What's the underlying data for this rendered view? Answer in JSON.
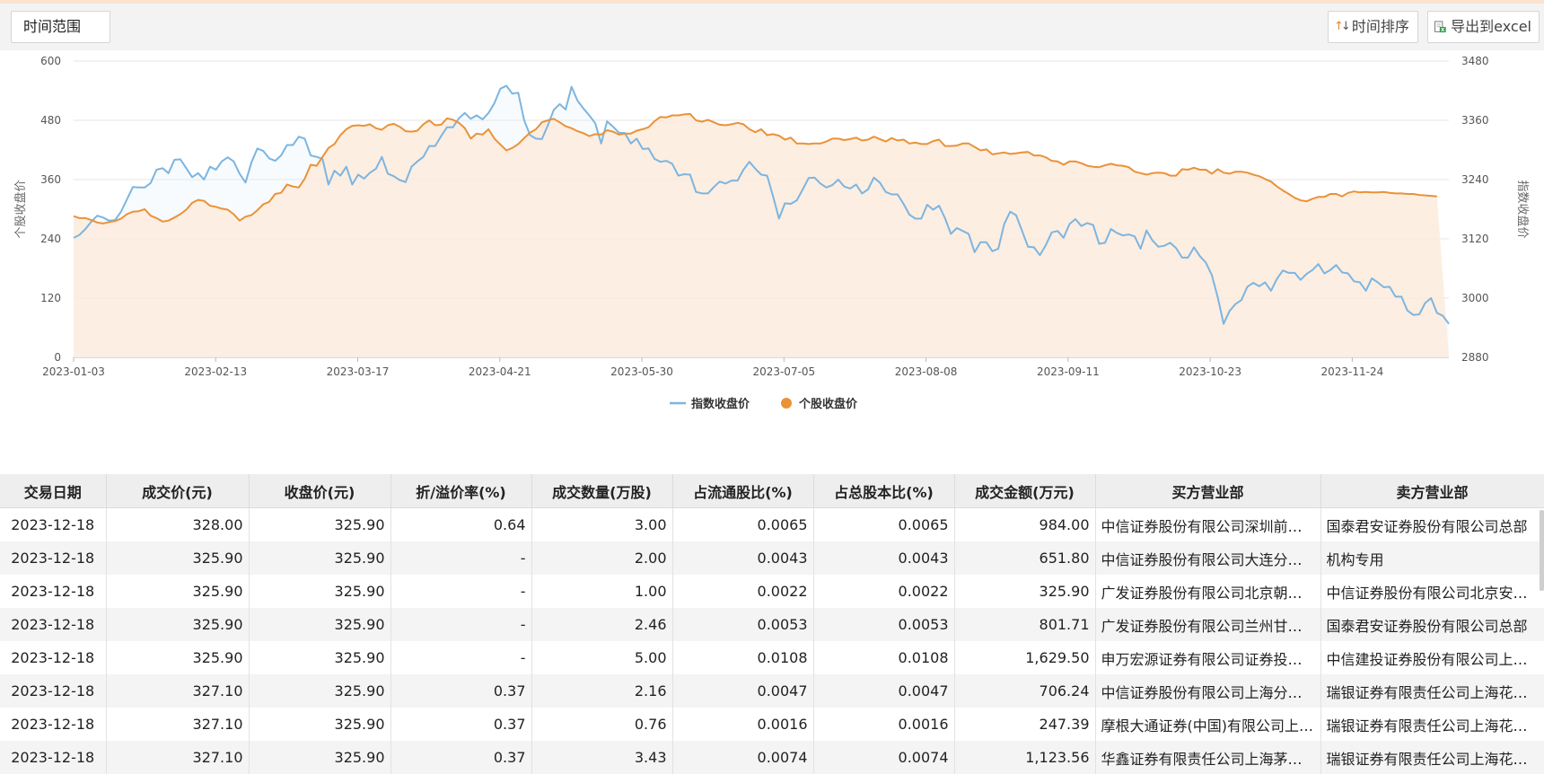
{
  "toolbar": {
    "range_label": "时间范围",
    "sort_label": "时间排序",
    "export_label": "导出到excel"
  },
  "chart_data": {
    "type": "line",
    "x_ticks": [
      "2023-01-03",
      "2023-02-13",
      "2023-03-17",
      "2023-04-21",
      "2023-05-30",
      "2023-07-05",
      "2023-08-08",
      "2023-09-11",
      "2023-10-23",
      "2023-11-24"
    ],
    "left_axis": {
      "label": "个股收盘价",
      "ticks": [
        0,
        120,
        240,
        360,
        480,
        600
      ],
      "range": [
        0,
        600
      ]
    },
    "right_axis": {
      "label": "指数收盘价",
      "ticks": [
        2880,
        3000,
        3120,
        3240,
        3360,
        3480
      ],
      "range": [
        2880,
        3480
      ]
    },
    "legend_position": "bottom-center",
    "grid": true,
    "series": [
      {
        "name": "指数收盘价",
        "axis": "right",
        "color": "#7cb5e0",
        "values": [
          3122,
          3128,
          3140,
          3155,
          3167,
          3163,
          3157,
          3158,
          3175,
          3200,
          3225,
          3224,
          3224,
          3233,
          3260,
          3263,
          3253,
          3280,
          3281,
          3263,
          3245,
          3253,
          3240,
          3266,
          3260,
          3277,
          3285,
          3277,
          3252,
          3234,
          3275,
          3303,
          3298,
          3283,
          3278,
          3289,
          3310,
          3310,
          3327,
          3323,
          3289,
          3286,
          3282,
          3230,
          3258,
          3248,
          3266,
          3230,
          3250,
          3242,
          3254,
          3262,
          3286,
          3252,
          3247,
          3239,
          3235,
          3266,
          3277,
          3286,
          3308,
          3308,
          3328,
          3346,
          3346,
          3364,
          3375,
          3363,
          3370,
          3362,
          3375,
          3395,
          3424,
          3430,
          3414,
          3416,
          3360,
          3330,
          3323,
          3322,
          3350,
          3381,
          3393,
          3382,
          3428,
          3400,
          3384,
          3370,
          3354,
          3313,
          3358,
          3347,
          3335,
          3334,
          3313,
          3323,
          3302,
          3303,
          3282,
          3276,
          3278,
          3272,
          3248,
          3251,
          3250,
          3215,
          3212,
          3212,
          3225,
          3236,
          3232,
          3238,
          3238,
          3260,
          3276,
          3262,
          3250,
          3248,
          3206,
          3161,
          3192,
          3191,
          3198,
          3220,
          3243,
          3244,
          3232,
          3224,
          3229,
          3240,
          3226,
          3222,
          3230,
          3212,
          3220,
          3244,
          3234,
          3215,
          3210,
          3210,
          3191,
          3169,
          3161,
          3161,
          3189,
          3179,
          3187,
          3162,
          3130,
          3142,
          3136,
          3130,
          3093,
          3113,
          3113,
          3095,
          3100,
          3150,
          3175,
          3168,
          3136,
          3104,
          3103,
          3087,
          3107,
          3133,
          3136,
          3122,
          3150,
          3160,
          3146,
          3152,
          3148,
          3110,
          3112,
          3140,
          3132,
          3127,
          3129,
          3125,
          3100,
          3137,
          3117,
          3104,
          3106,
          3112,
          3101,
          3082,
          3082,
          3103,
          3085,
          3072,
          3047,
          3002,
          2948,
          2974,
          2988,
          2996,
          3023,
          3031,
          3024,
          3032,
          3015,
          3039,
          3056,
          3051,
          3051,
          3037,
          3049,
          3057,
          3069,
          3050,
          3057,
          3067,
          3052,
          3050,
          3034,
          3032,
          3015,
          3040,
          3032,
          3022,
          3023,
          3003,
          3003,
          2975,
          2966,
          2967,
          2990,
          3000,
          2970,
          2964,
          2948
        ]
      },
      {
        "name": "个股收盘价",
        "axis": "left",
        "color": "#ea9238",
        "values": [
          286,
          282,
          282,
          278,
          273,
          271,
          274,
          276,
          281,
          290,
          295,
          296,
          300,
          287,
          282,
          275,
          277,
          283,
          290,
          299,
          313,
          319,
          317,
          307,
          305,
          301,
          299,
          290,
          277,
          285,
          288,
          298,
          310,
          315,
          331,
          333,
          350,
          346,
          344,
          362,
          390,
          388,
          406,
          424,
          432,
          450,
          462,
          469,
          470,
          469,
          472,
          464,
          461,
          470,
          473,
          467,
          458,
          457,
          459,
          472,
          480,
          470,
          471,
          484,
          481,
          475,
          464,
          443,
          453,
          451,
          462,
          443,
          431,
          419,
          424,
          432,
          444,
          455,
          462,
          476,
          480,
          483,
          476,
          468,
          464,
          458,
          454,
          448,
          452,
          451,
          460,
          457,
          451,
          453,
          453,
          459,
          462,
          466,
          478,
          487,
          486,
          490,
          490,
          492,
          493,
          480,
          477,
          481,
          476,
          471,
          470,
          472,
          475,
          472,
          462,
          456,
          462,
          450,
          452,
          449,
          441,
          445,
          433,
          433,
          432,
          433,
          433,
          437,
          443,
          443,
          440,
          442,
          445,
          439,
          441,
          447,
          442,
          437,
          444,
          439,
          441,
          433,
          435,
          432,
          432,
          438,
          441,
          428,
          428,
          429,
          433,
          433,
          426,
          419,
          421,
          411,
          413,
          415,
          412,
          413,
          415,
          416,
          409,
          409,
          405,
          398,
          397,
          390,
          397,
          397,
          393,
          388,
          386,
          385,
          389,
          392,
          389,
          388,
          385,
          376,
          373,
          370,
          373,
          374,
          373,
          368,
          368,
          381,
          380,
          384,
          380,
          380,
          372,
          381,
          374,
          372,
          376,
          376,
          374,
          370,
          367,
          361,
          356,
          346,
          338,
          331,
          323,
          318,
          316,
          321,
          325,
          325,
          331,
          331,
          326,
          333,
          336,
          334,
          335,
          334,
          334,
          335,
          333,
          332,
          332,
          331,
          331,
          329,
          328,
          327,
          326
        ]
      }
    ]
  },
  "table": {
    "headers": [
      "交易日期",
      "成交价(元)",
      "收盘价(元)",
      "折/溢价率(%)",
      "成交数量(万股)",
      "占流通股比(%)",
      "占总股本比(%)",
      "成交金额(万元)",
      "买方营业部",
      "卖方营业部"
    ],
    "rows": [
      [
        "2023-12-18",
        "328.00",
        "325.90",
        "0.64",
        "3.00",
        "0.0065",
        "0.0065",
        "984.00",
        "中信证券股份有限公司深圳前海分公司",
        "国泰君安证券股份有限公司总部"
      ],
      [
        "2023-12-18",
        "325.90",
        "325.90",
        "-",
        "2.00",
        "0.0043",
        "0.0043",
        "651.80",
        "中信证券股份有限公司大连分公司",
        "机构专用"
      ],
      [
        "2023-12-18",
        "325.90",
        "325.90",
        "-",
        "1.00",
        "0.0022",
        "0.0022",
        "325.90",
        "广发证券股份有限公司北京朝阳门证券营业部",
        "中信证券股份有限公司北京安外大街证券营业部"
      ],
      [
        "2023-12-18",
        "325.90",
        "325.90",
        "-",
        "2.46",
        "0.0053",
        "0.0053",
        "801.71",
        "广发证券股份有限公司兰州甘南路证券营业部",
        "国泰君安证券股份有限公司总部"
      ],
      [
        "2023-12-18",
        "325.90",
        "325.90",
        "-",
        "5.00",
        "0.0108",
        "0.0108",
        "1,629.50",
        "申万宏源证券有限公司证券投资总部",
        "中信建投证券股份有限公司上海分公司"
      ],
      [
        "2023-12-18",
        "327.10",
        "325.90",
        "0.37",
        "2.16",
        "0.0047",
        "0.0047",
        "706.24",
        "中信证券股份有限公司上海分公司",
        "瑞银证券有限责任公司上海花园石桥路证券营业部"
      ],
      [
        "2023-12-18",
        "327.10",
        "325.90",
        "0.37",
        "0.76",
        "0.0016",
        "0.0016",
        "247.39",
        "摩根大通证券(中国)有限公司上海银城中路证券营业部",
        "瑞银证券有限责任公司上海花园石桥路证券营业部"
      ],
      [
        "2023-12-18",
        "327.10",
        "325.90",
        "0.37",
        "3.43",
        "0.0074",
        "0.0074",
        "1,123.56",
        "华鑫证券有限责任公司上海茅台路证券营业部",
        "瑞银证券有限责任公司上海花园石桥路证券营业部"
      ]
    ]
  }
}
